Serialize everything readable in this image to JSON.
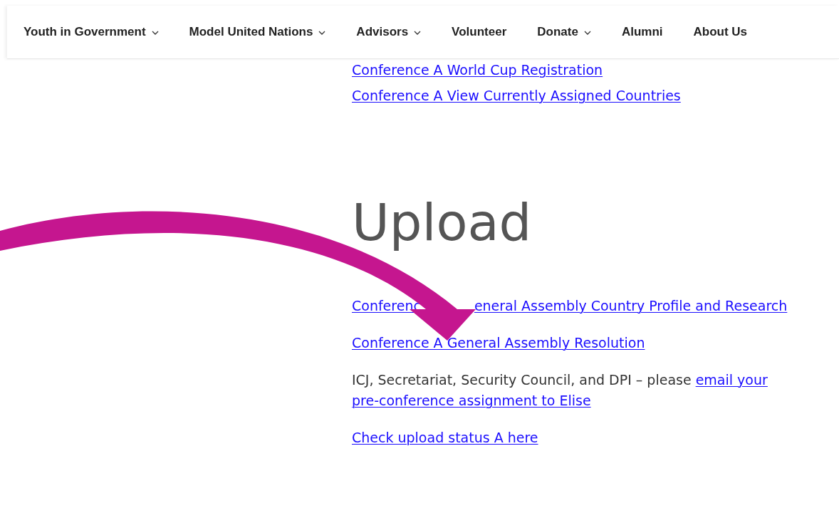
{
  "nav": [
    {
      "label": "Youth in Government",
      "has_menu": true
    },
    {
      "label": "Model United Nations",
      "has_menu": true
    },
    {
      "label": "Advisors",
      "has_menu": true
    },
    {
      "label": "Volunteer",
      "has_menu": false
    },
    {
      "label": "Donate",
      "has_menu": true
    },
    {
      "label": "Alumni",
      "has_menu": false
    },
    {
      "label": "About Us",
      "has_menu": false
    }
  ],
  "top_links": [
    "Conference A World Cup Registration",
    "Conference A View Currently Assigned Countries"
  ],
  "section": {
    "heading": "Upload",
    "items": [
      {
        "kind": "split_link",
        "segments": [
          "Conferenc",
          "eneral Assembly Country Profile and Research"
        ]
      },
      {
        "kind": "link",
        "text": "Conference A General Assembly Resolution"
      },
      {
        "kind": "note",
        "text": "ICJ, Secretariat, Security Council, and DPI – please",
        "link_lines": [
          "email your",
          "pre-conference assignment to Elise"
        ]
      },
      {
        "kind": "link",
        "text": "Check upload status A here"
      }
    ]
  }
}
